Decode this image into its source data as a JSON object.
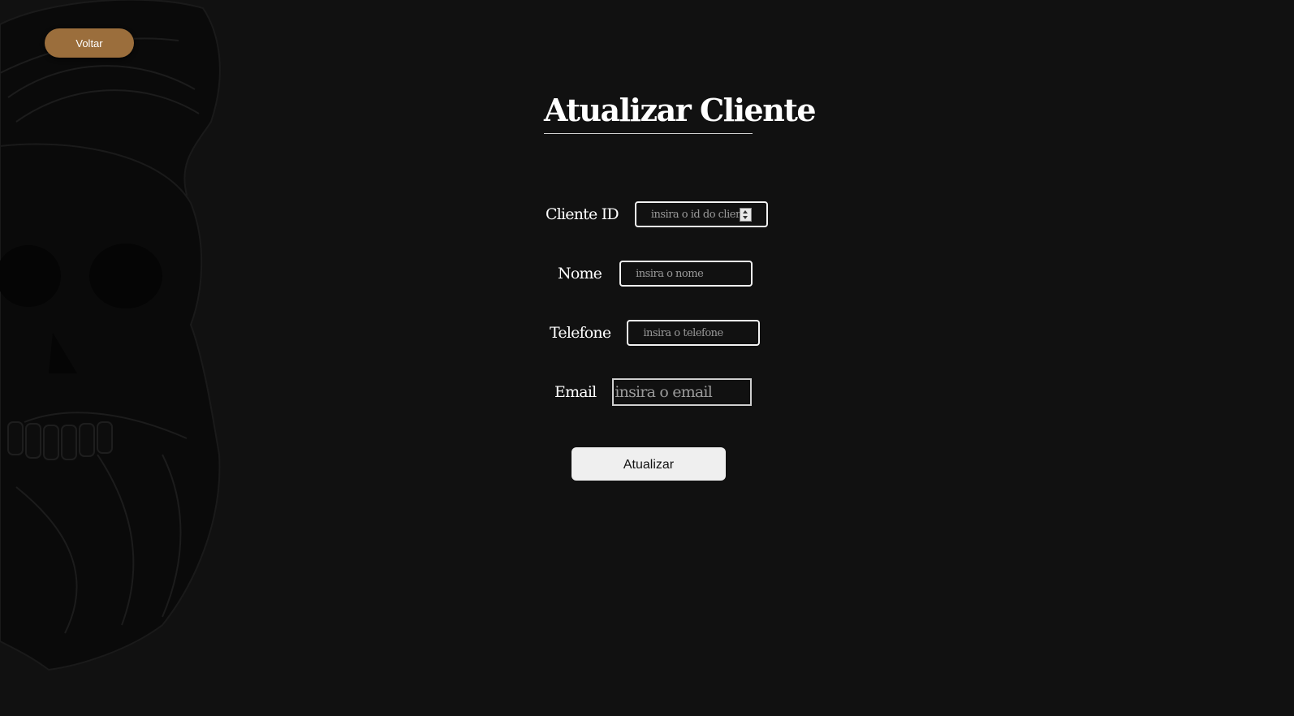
{
  "nav": {
    "back_label": "Voltar"
  },
  "page": {
    "title": "Atualizar Cliente"
  },
  "form": {
    "cliente_id": {
      "label": "Cliente ID",
      "placeholder": "insira o id do cliente",
      "value": ""
    },
    "nome": {
      "label": "Nome",
      "placeholder": "insira o nome",
      "value": ""
    },
    "telefone": {
      "label": "Telefone",
      "placeholder": "insira o telefone",
      "value": ""
    },
    "email": {
      "label": "Email",
      "placeholder": "insira o email",
      "value": ""
    },
    "submit_label": "Atualizar"
  },
  "colors": {
    "background": "#111111",
    "accent": "#9b6e3c",
    "text": "#ffffff",
    "button": "#efefef"
  },
  "icons": {
    "background_art": "bearded-skull-icon",
    "number_spinner": "spinner-arrows-icon"
  }
}
